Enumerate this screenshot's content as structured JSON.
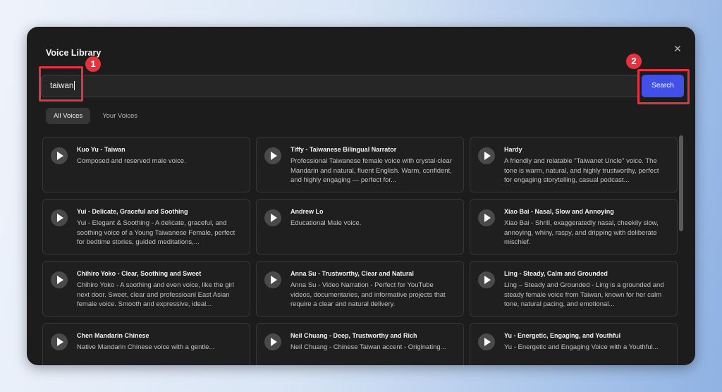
{
  "modal": {
    "title": "Voice Library",
    "close_icon": "close-icon"
  },
  "search": {
    "value": "taiwan",
    "button_label": "Search"
  },
  "tabs": [
    {
      "label": "All Voices",
      "active": true
    },
    {
      "label": "Your Voices",
      "active": false
    }
  ],
  "voices": [
    {
      "name": "Kuo Yu - Taiwan",
      "description": "Composed and reserved male voice."
    },
    {
      "name": "Tiffy - Taiwanese Bilingual Narrator",
      "description": "Professional Taiwanese female voice with crystal-clear Mandarin and natural, fluent English. Warm, confident, and highly engaging — perfect for..."
    },
    {
      "name": "Hardy",
      "description": "A friendly and relatable \"Taiwanet Uncle\" voice. The tone is warm, natural, and highly trustworthy, perfect for engaging storytelling, casual podcast..."
    },
    {
      "name": "Yui - Delicate, Graceful and Soothing",
      "description": "Yui - Elegant & Soothing - A delicate, graceful, and soothing voice of a Young Taiwanese Female, perfect for bedtime stories, guided meditations,..."
    },
    {
      "name": "Andrew Lo",
      "description": "Educational Male voice."
    },
    {
      "name": "Xiao Bai - Nasal, Slow and Annoying",
      "description": "Xiao Bai - Shrill, exaggeratedly nasal, cheekily slow, annoying, whiny, raspy, and dripping with deliberate mischief."
    },
    {
      "name": "Chihiro Yoko - Clear, Soothing and Sweet",
      "description": "Chihiro Yoko - A soothing and even voice, like the girl next door. Sweet, clear and professioanl East Asian female voice. Smooth and expressive, ideal..."
    },
    {
      "name": "Anna Su - Trustworthy, Clear and Natural",
      "description": "Anna Su - Video Narration - Perfect for YouTube videos, documentaries, and informative projects that require a clear and natural delivery."
    },
    {
      "name": "Ling - Steady, Calm and Grounded",
      "description": "Ling – Steady and Grounded - Ling is a grounded and steady female voice from Taiwan, known for her calm tone, natural pacing, and emotional..."
    },
    {
      "name": "Chen Mandarin Chinese",
      "description": "Native Mandarin Chinese voice with a gentle..."
    },
    {
      "name": "Neil Chuang - Deep, Trustworthy and Rich",
      "description": "Neil Chuang - Chinese Taiwan accent - Originating..."
    },
    {
      "name": "Yu - Energetic, Engaging, and Youthful",
      "description": "Yu - Energetic and Engaging Voice with a Youthful..."
    }
  ],
  "annotations": [
    {
      "number": "1"
    },
    {
      "number": "2"
    }
  ],
  "colors": {
    "accent": "#4250e8",
    "callout": "#e5323e",
    "panel": "#1c1c1c"
  }
}
